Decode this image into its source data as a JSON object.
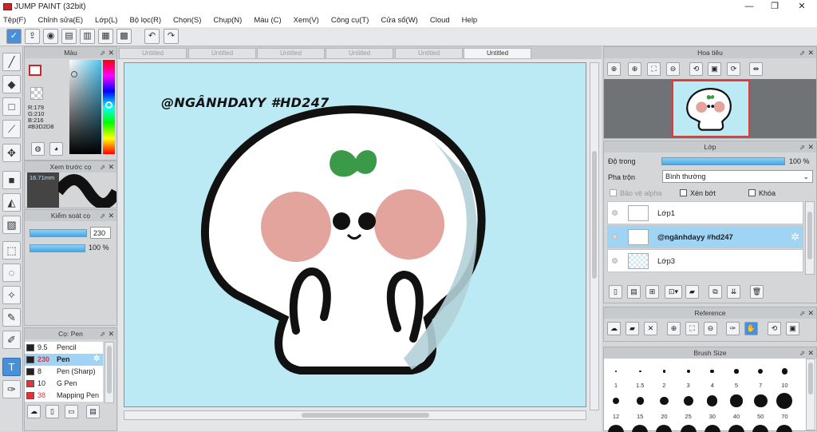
{
  "app": {
    "title": "JUMP PAINT (32bit)"
  },
  "window_controls": {
    "minimize": "—",
    "restore": "❐",
    "close": "✕"
  },
  "menu": [
    "Tệp(F)",
    "Chỉnh sửa(E)",
    "Lớp(L)",
    "Bộ lọc(R)",
    "Chọn(S)",
    "Chụp(N)",
    "Màu (C)",
    "Xem(V)",
    "Công cụ(T)",
    "Cửa sổ(W)",
    "Cloud",
    "Help"
  ],
  "tabs": [
    "Untitled",
    "Untitled",
    "Untitled",
    "Untitled",
    "Untitled",
    "Untitled"
  ],
  "color_panel": {
    "title": "Màu",
    "r": "R:179",
    "g": "G:210",
    "b": "B:216",
    "hex": "#B3D2D8",
    "current_color": "#B3D2D8"
  },
  "brush_preview": {
    "title": "Xem trước cọ",
    "size": "16.71mm"
  },
  "brush_control": {
    "title": "Kiểm soát cọ",
    "size_value": "230",
    "opacity_value": "100 %"
  },
  "brush_list": {
    "title": "Cọ: Pen",
    "items": [
      {
        "size": "9.5",
        "name": "Pencil",
        "color": "#222222",
        "selected": false
      },
      {
        "size": "230",
        "name": "Pen",
        "color": "#222222",
        "selected": true
      },
      {
        "size": "8",
        "name": "Pen (Sharp)",
        "color": "#222222",
        "selected": false
      },
      {
        "size": "10",
        "name": "G Pen",
        "color": "#e8303a",
        "selected": false
      },
      {
        "size": "38",
        "name": "Mapping Pen",
        "color": "#e8303a",
        "selected": false
      }
    ]
  },
  "canvas": {
    "text": "@NGÂNHDAYY #HD247",
    "background": "#bbeaf5"
  },
  "navigator": {
    "title": "Hoa tiêu"
  },
  "layer_panel": {
    "title": "Lớp",
    "opacity_label": "Độ trong",
    "opacity_value": "100 %",
    "blend_label": "Pha trộn",
    "blend_value": "Bình thường",
    "protect_alpha": "Bảo vệ alpha",
    "clipping": "Xén bớt",
    "lock": "Khóa",
    "layers": [
      {
        "name": "Lớp1",
        "selected": false
      },
      {
        "name": "@ngânhdayy #hd247",
        "selected": true
      },
      {
        "name": "Lớp3",
        "selected": false
      }
    ]
  },
  "reference": {
    "title": "Reference"
  },
  "brush_size": {
    "title": "Brush Size",
    "row1": [
      "1",
      "1.5",
      "2",
      "3",
      "4",
      "5",
      "7",
      "10"
    ],
    "row2": [
      "12",
      "15",
      "20",
      "25",
      "30",
      "40",
      "50",
      "70"
    ]
  }
}
